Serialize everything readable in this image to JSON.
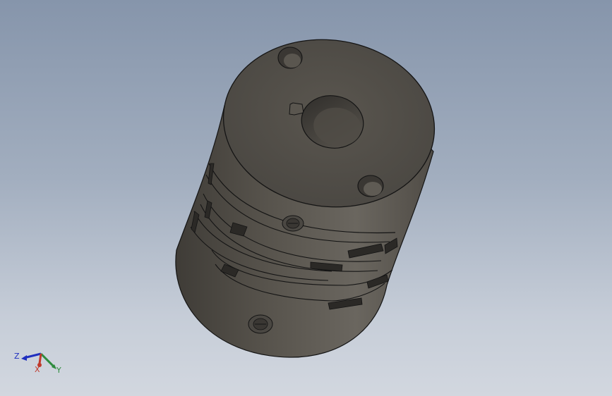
{
  "app": {
    "view": "3d-model-viewport",
    "model_name": ""
  },
  "triad": {
    "x_label": "X",
    "y_label": "Y",
    "z_label": "Z",
    "colors": {
      "x": "#c0392b",
      "y": "#2e8b3d",
      "z": "#1f2fbf"
    }
  },
  "colors": {
    "background_top": "#8695ab",
    "background_bottom": "#d2d7df",
    "part_body": "#5c5851",
    "part_face": "#55514b",
    "edge": "#141414"
  },
  "icons": {
    "triad": "view-orientation-triad-icon",
    "part": "flexible-disc-coupling-icon"
  }
}
